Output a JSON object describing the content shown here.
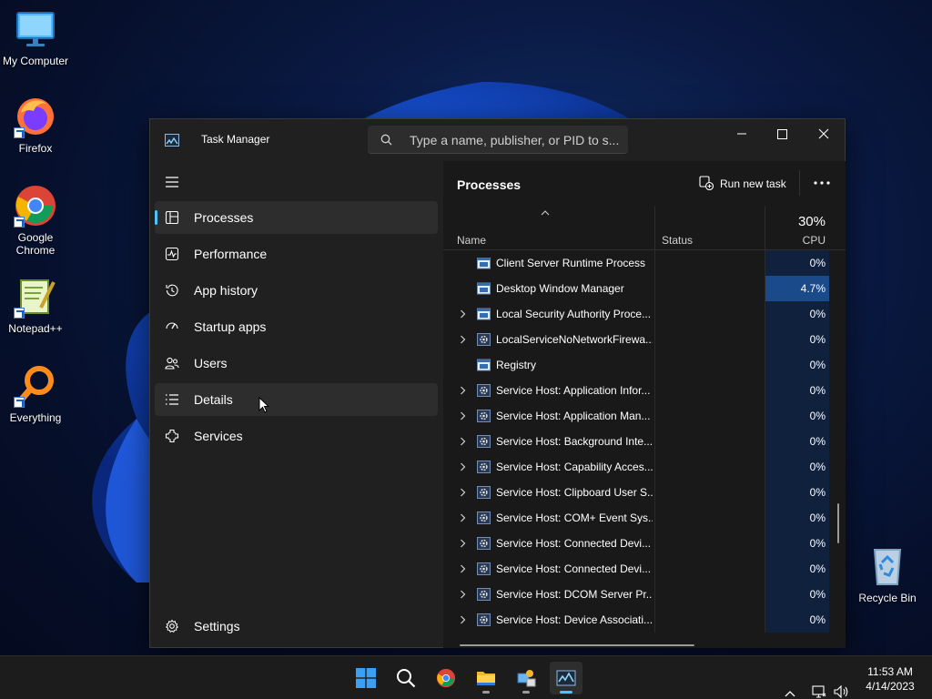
{
  "desktop": {
    "icons": [
      {
        "label": "My Computer"
      },
      {
        "label": "Firefox"
      },
      {
        "label": "Google Chrome"
      },
      {
        "label": "Notepad++"
      },
      {
        "label": "Everything"
      },
      {
        "label": "Recycle Bin"
      }
    ]
  },
  "task_manager": {
    "title": "Task Manager",
    "search_placeholder": "Type a name, publisher, or PID to s...",
    "nav": [
      {
        "label": "Processes",
        "icon": "processes-icon",
        "active": true
      },
      {
        "label": "Performance",
        "icon": "performance-icon"
      },
      {
        "label": "App history",
        "icon": "app-history-icon"
      },
      {
        "label": "Startup apps",
        "icon": "startup-apps-icon"
      },
      {
        "label": "Users",
        "icon": "users-icon"
      },
      {
        "label": "Details",
        "icon": "details-icon"
      },
      {
        "label": "Services",
        "icon": "services-icon"
      }
    ],
    "settings_label": "Settings",
    "page_title": "Processes",
    "run_new_task": "Run new task",
    "columns": {
      "name": "Name",
      "status": "Status",
      "cpu_total": "30%",
      "cpu": "CPU"
    },
    "processes": [
      {
        "name": "Client Server Runtime Process",
        "cpu": "0%",
        "expandable": false,
        "icon": "window-icon"
      },
      {
        "name": "Desktop Window Manager",
        "cpu": "4.7%",
        "expandable": false,
        "icon": "window-icon",
        "highlight": true
      },
      {
        "name": "Local Security Authority Proce...",
        "cpu": "0%",
        "expandable": true,
        "icon": "window-icon"
      },
      {
        "name": "LocalServiceNoNetworkFirewa...",
        "cpu": "0%",
        "expandable": true,
        "icon": "gear-icon"
      },
      {
        "name": "Registry",
        "cpu": "0%",
        "expandable": false,
        "icon": "window-icon"
      },
      {
        "name": "Service Host: Application Infor...",
        "cpu": "0%",
        "expandable": true,
        "icon": "gear-icon"
      },
      {
        "name": "Service Host: Application Man...",
        "cpu": "0%",
        "expandable": true,
        "icon": "gear-icon"
      },
      {
        "name": "Service Host: Background Inte...",
        "cpu": "0%",
        "expandable": true,
        "icon": "gear-icon"
      },
      {
        "name": "Service Host: Capability Acces...",
        "cpu": "0%",
        "expandable": true,
        "icon": "gear-icon"
      },
      {
        "name": "Service Host: Clipboard User S...",
        "cpu": "0%",
        "expandable": true,
        "icon": "gear-icon"
      },
      {
        "name": "Service Host: COM+ Event Sys...",
        "cpu": "0%",
        "expandable": true,
        "icon": "gear-icon"
      },
      {
        "name": "Service Host: Connected Devi...",
        "cpu": "0%",
        "expandable": true,
        "icon": "gear-icon"
      },
      {
        "name": "Service Host: Connected Devi...",
        "cpu": "0%",
        "expandable": true,
        "icon": "gear-icon"
      },
      {
        "name": "Service Host: DCOM Server Pr...",
        "cpu": "0%",
        "expandable": true,
        "icon": "gear-icon"
      },
      {
        "name": "Service Host: Device Associati...",
        "cpu": "0%",
        "expandable": true,
        "icon": "gear-icon"
      }
    ]
  },
  "taskbar": {
    "time": "11:53 AM",
    "date": "4/14/2023",
    "apps": [
      "start-icon",
      "search-icon",
      "chrome-icon",
      "file-explorer-icon",
      "control-panel-icon",
      "task-manager-icon"
    ]
  },
  "colors": {
    "accent": "#4cc2ff",
    "cpu_highlight": "#1a4a8a",
    "cpu_column": "#10213d"
  }
}
